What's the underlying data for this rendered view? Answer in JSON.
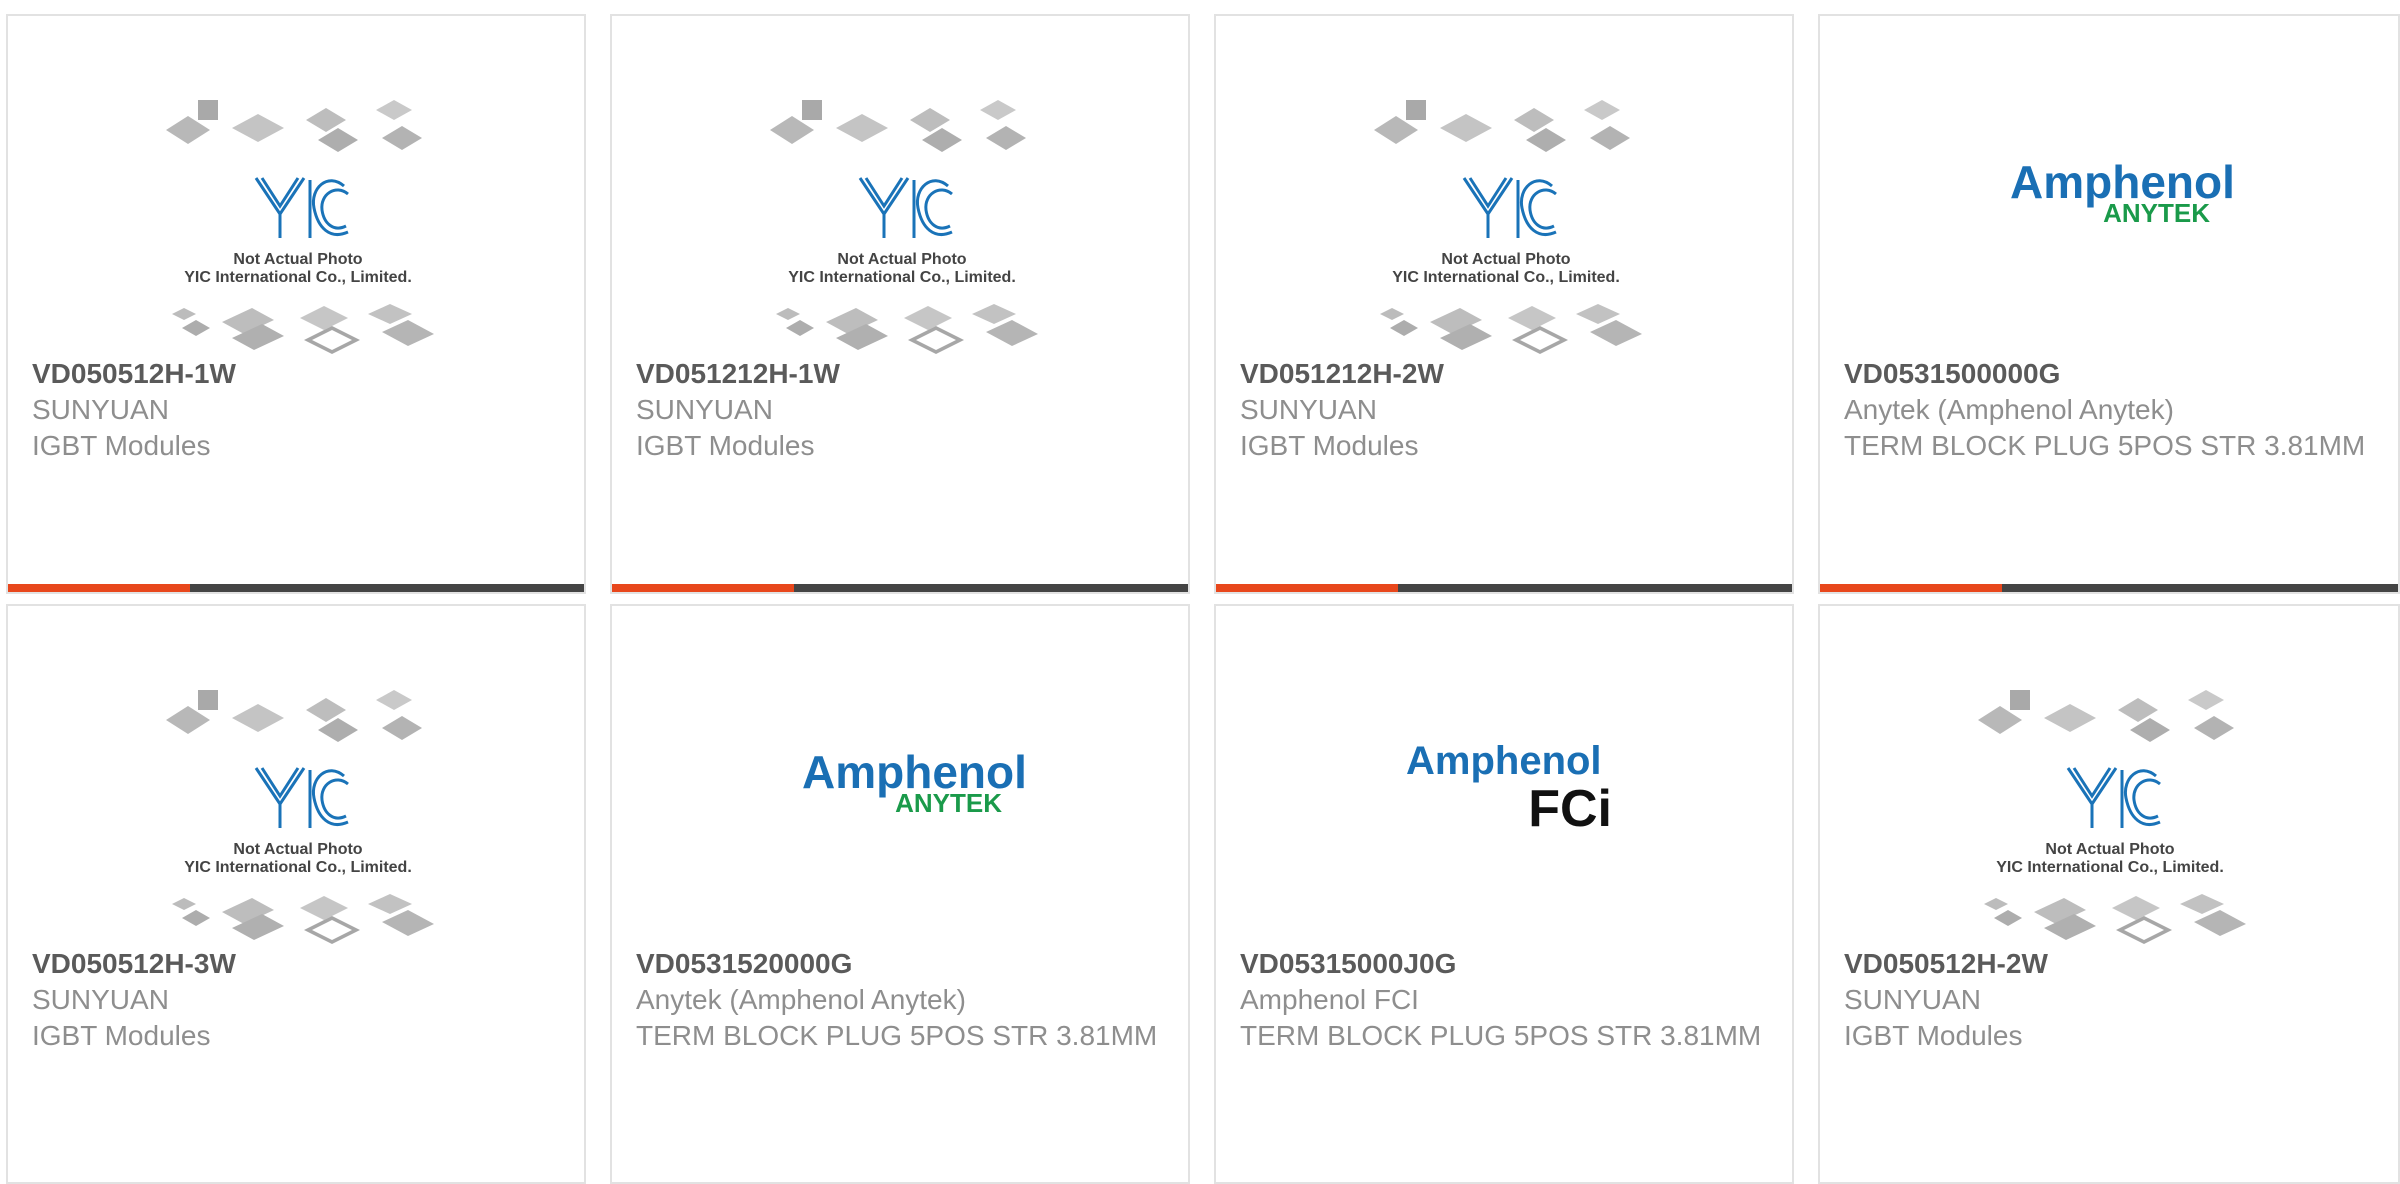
{
  "accent_color": "#e8471c",
  "bar_color": "#444444",
  "placeholder": {
    "line1": "Not Actual Photo",
    "line2": "YIC International Co., Limited."
  },
  "logos": {
    "amphenol": "Amphenol",
    "anytek": "ANYTEK",
    "fci": "FCi"
  },
  "products": [
    {
      "part": "VD050512H-1W",
      "maker": "SUNYUAN",
      "desc": "IGBT Modules",
      "image": "yic-placeholder"
    },
    {
      "part": "VD051212H-1W",
      "maker": "SUNYUAN",
      "desc": "IGBT Modules",
      "image": "yic-placeholder"
    },
    {
      "part": "VD051212H-2W",
      "maker": "SUNYUAN",
      "desc": "IGBT Modules",
      "image": "yic-placeholder"
    },
    {
      "part": "VD0531500000G",
      "maker": "Anytek (Amphenol Anytek)",
      "desc": "TERM BLOCK PLUG 5POS STR 3.81MM",
      "image": "amphenol-anytek-logo"
    },
    {
      "part": "VD050512H-3W",
      "maker": "SUNYUAN",
      "desc": "IGBT Modules",
      "image": "yic-placeholder"
    },
    {
      "part": "VD0531520000G",
      "maker": "Anytek (Amphenol Anytek)",
      "desc": "TERM BLOCK PLUG 5POS STR 3.81MM",
      "image": "amphenol-anytek-logo"
    },
    {
      "part": "VD05315000J0G",
      "maker": "Amphenol FCI",
      "desc": "TERM BLOCK PLUG 5POS STR 3.81MM",
      "image": "amphenol-fci-logo"
    },
    {
      "part": "VD050512H-2W",
      "maker": "SUNYUAN",
      "desc": "IGBT Modules",
      "image": "yic-placeholder"
    }
  ]
}
